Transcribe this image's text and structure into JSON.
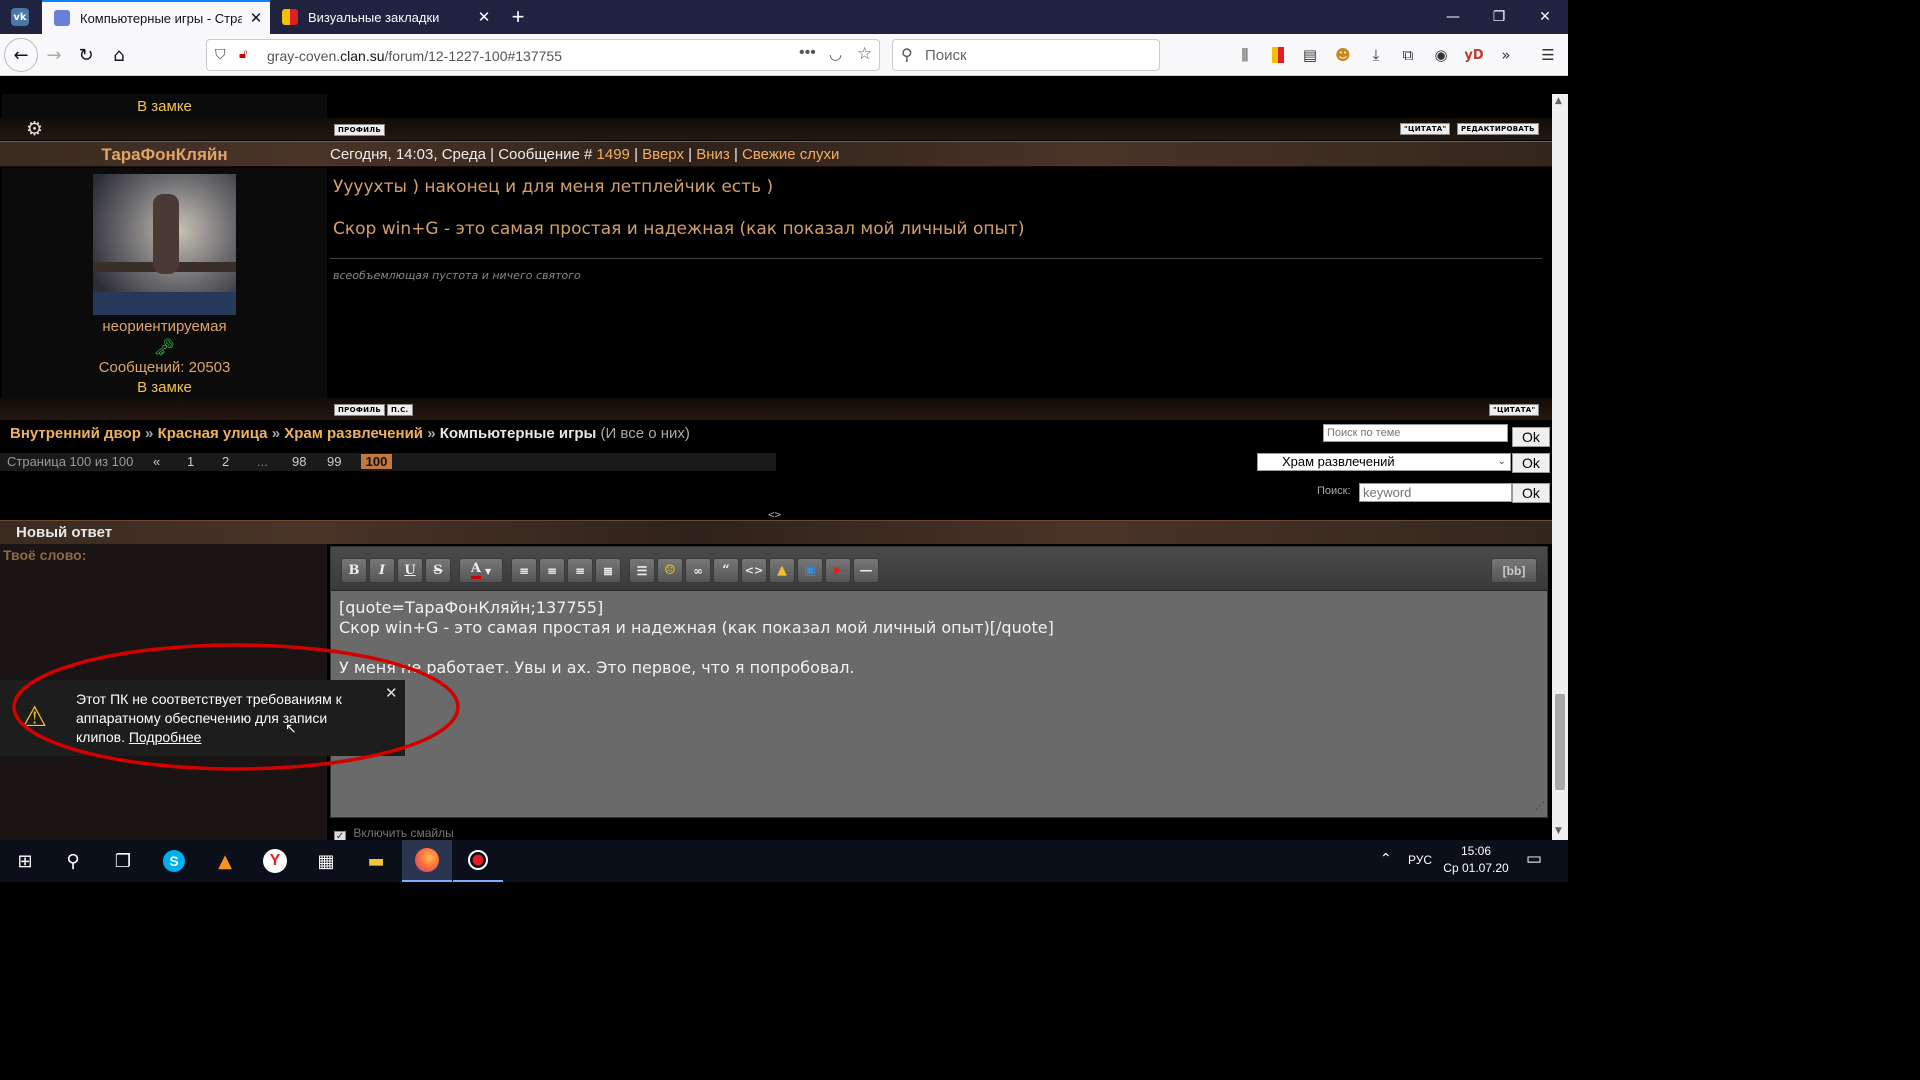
{
  "browser": {
    "tabs": [
      {
        "title": "Компьютерные игры - Стран",
        "close": "✕"
      },
      {
        "title": "Визуальные закладки",
        "close": "✕"
      }
    ],
    "new_tab": "+",
    "url_host": "gray-coven.",
    "url_domain": "clan.su",
    "url_path": "/forum/12-1227-100#137755",
    "search_placeholder": "Поиск",
    "win_min": "—",
    "win_max": "❐",
    "win_close": "✕"
  },
  "forum": {
    "prev_user_status": "В замке",
    "prev_post_buttons": {
      "profile": "ПРОФИЛЬ",
      "quote": "\"ЦИТАТА\"",
      "edit": "РЕДАКТИРОВАТЬ"
    },
    "post": {
      "author": "ТараФонКляйн",
      "meta_prefix": "Сегодня, 14:03, Среда | Сообщение #",
      "post_number": "1499",
      "sep1": "|",
      "up": "Вверх",
      "sep2": "|",
      "down": "Вниз",
      "sep3": "|",
      "news": "Свежие слухи",
      "line1": "Уууухты ) наконец и для меня летплейчик есть )",
      "line2": "Скор win+G - это самая простая и надежная (как показал мой личный опыт)",
      "signature": "всеобъемлющая пустота и ничего святого",
      "user_title": "неориентируемая",
      "messages_count": "Сообщений: 20503",
      "status": "В замке",
      "btn_profile": "ПРОФИЛЬ",
      "btn_pm": "П.С.",
      "btn_quote": "\"ЦИТАТА\""
    },
    "breadcrumb": {
      "c1": "Внутренний двор",
      "sep": "»",
      "c2": "Красная улица",
      "c3": "Храм развлечений",
      "c4": "Компьютерные игры",
      "c4_note": "(И все о них)"
    },
    "topic_search_placeholder": "Поиск по теме",
    "ok": "Ok",
    "pagination": {
      "label": "Страница 100 из 100",
      "prev": "«",
      "pages": [
        "1",
        "2",
        "...",
        "98",
        "99"
      ],
      "current": "100"
    },
    "forum_select": "Храм развлечений",
    "search_label": "Поиск:",
    "keyword_placeholder": "keyword",
    "collapse_toggle": "<>",
    "reply": {
      "title": "Новый ответ",
      "your_word": "Твоё слово:",
      "bb_button": "[bb]",
      "text_line1": "[quote=ТараФонКляйн;137755]",
      "text_line2": "Скор win+G - это самая простая и надежная (как показал мой личный опыт)[/quote]",
      "text_line3": "У меня не работает. Увы и ах. Это первое, что я попробовал.",
      "smileys_label": "Включить смайлы"
    }
  },
  "toast": {
    "message": "Этот ПК не соответствует требованиям к аппаратному обеспечению для записи клипов.",
    "link": "Подробнее",
    "close": "✕"
  },
  "taskbar": {
    "lang": "РУС",
    "time": "15:06",
    "date": "Ср 01.07.20"
  },
  "colors": {
    "accent_tab": "#0a84ff",
    "annotation": "#d40000",
    "gold": "#f0c44c"
  }
}
